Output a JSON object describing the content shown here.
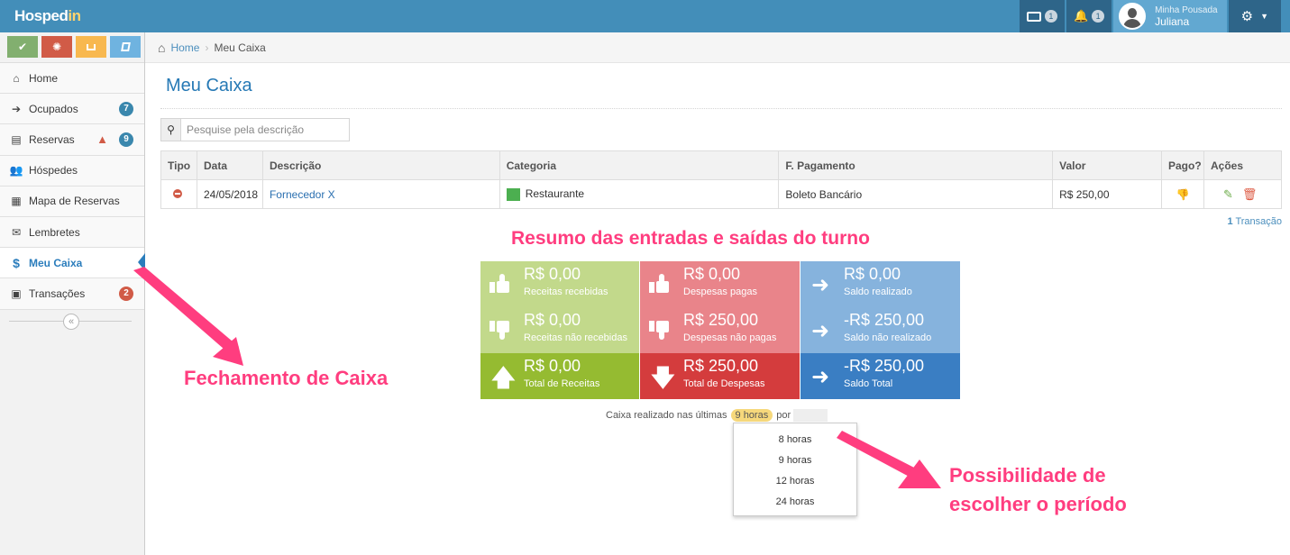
{
  "navbar": {
    "brand_main": "Hosped",
    "brand_in": "in",
    "cash_count": "1",
    "bell_count": "1",
    "user_small": "Minha Pousada",
    "user_name": "Juliana"
  },
  "shortcuts": [
    {
      "icon": "check-icon",
      "color": "#82af6f"
    },
    {
      "icon": "cog-icon",
      "color": "#d15b47"
    },
    {
      "icon": "inbox-icon",
      "color": "#f8b84f"
    },
    {
      "icon": "book-icon",
      "color": "#6fb3e0"
    }
  ],
  "sidebar": {
    "items": [
      {
        "label": "Home",
        "icon": "home-icon"
      },
      {
        "label": "Ocupados",
        "icon": "sign-in-icon",
        "badge": "7"
      },
      {
        "label": "Reservas",
        "icon": "book-icon",
        "badge": "9",
        "warning": true
      },
      {
        "label": "Hóspedes",
        "icon": "users-icon"
      },
      {
        "label": "Mapa de Reservas",
        "icon": "calendar-icon"
      },
      {
        "label": "Lembretes",
        "icon": "envelope-icon"
      },
      {
        "label": "Meu Caixa",
        "icon": "dollar-icon",
        "active": true
      },
      {
        "label": "Transações",
        "icon": "money-icon",
        "badge": "2"
      }
    ]
  },
  "breadcrumb": {
    "home": "Home",
    "current": "Meu Caixa"
  },
  "page": {
    "title": "Meu Caixa"
  },
  "search": {
    "placeholder": "Pesquise pela descrição"
  },
  "table": {
    "headers": [
      "Tipo",
      "Data",
      "Descrição",
      "Categoria",
      "F. Pagamento",
      "Valor",
      "Pago?",
      "Ações"
    ],
    "rows": [
      {
        "tipo": "despesa",
        "data": "24/05/2018",
        "descricao": "Fornecedor X",
        "categoria": "Restaurante",
        "categoria_color": "#4caf50",
        "pagamento": "Boleto Bancário",
        "valor": "R$ 250,00"
      }
    ],
    "count": "1",
    "count_label": "Transação"
  },
  "annotations": {
    "top": "Resumo das entradas e saídas do turno",
    "left": "Fechamento de Caixa",
    "right": "Possibilidade de escolher o período"
  },
  "summary": {
    "receitas_recebidas": {
      "amount": "R$ 0,00",
      "label": "Receitas recebidas"
    },
    "despesas_pagas": {
      "amount": "R$ 0,00",
      "label": "Despesas pagas"
    },
    "saldo_realizado": {
      "amount": "R$ 0,00",
      "label": "Saldo realizado"
    },
    "receitas_nao_recebidas": {
      "amount": "R$ 0,00",
      "label": "Receitas não recebidas"
    },
    "despesas_nao_pagas": {
      "amount": "R$ 250,00",
      "label": "Despesas não pagas"
    },
    "saldo_nao_realizado": {
      "amount": "-R$ 250,00",
      "label": "Saldo não realizado"
    },
    "total_receitas": {
      "amount": "R$ 0,00",
      "label": "Total de Receitas"
    },
    "total_despesas": {
      "amount": "R$ 250,00",
      "label": "Total de Despesas"
    },
    "saldo_total": {
      "amount": "-R$ 250,00",
      "label": "Saldo Total"
    }
  },
  "period": {
    "prefix": "Caixa realizado nas últimas",
    "selected": "9 horas",
    "suffix": "por",
    "options": [
      "8 horas",
      "9 horas",
      "12 horas",
      "24 horas"
    ]
  },
  "colors": {
    "navbar": "#438eb9",
    "accent": "#2679b5",
    "annotation": "#ff3d7f"
  }
}
